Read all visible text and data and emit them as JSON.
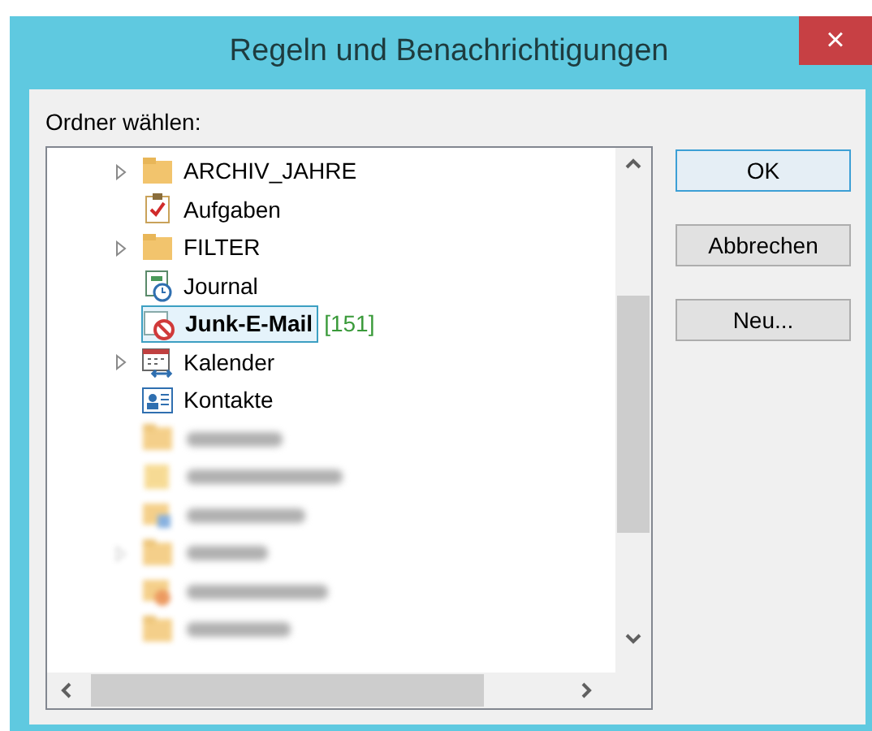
{
  "window": {
    "title": "Regeln und Benachrichtigungen",
    "close": "×"
  },
  "prompt": "Ordner wählen:",
  "folders": [
    {
      "label": "ARCHIV_JAHRE",
      "kind": "folder",
      "expandable": true,
      "selected": false
    },
    {
      "label": "Aufgaben",
      "kind": "tasks",
      "expandable": false,
      "selected": false
    },
    {
      "label": "FILTER",
      "kind": "folder",
      "expandable": true,
      "selected": false
    },
    {
      "label": "Journal",
      "kind": "journal",
      "expandable": false,
      "selected": false
    },
    {
      "label": "Junk-E-Mail",
      "kind": "junk",
      "expandable": false,
      "selected": true,
      "count": "[151]"
    },
    {
      "label": "Kalender",
      "kind": "calendar",
      "expandable": true,
      "selected": false
    },
    {
      "label": "Kontakte",
      "kind": "contacts",
      "expandable": false,
      "selected": false
    },
    {
      "kind": "folder",
      "blurred": true,
      "expandable": false,
      "selected": false
    },
    {
      "kind": "note",
      "blurred": true,
      "expandable": false,
      "selected": false
    },
    {
      "kind": "outbox",
      "blurred": true,
      "expandable": false,
      "selected": false
    },
    {
      "kind": "folder",
      "blurred": true,
      "expandable": true,
      "selected": false
    },
    {
      "kind": "rss",
      "blurred": true,
      "expandable": false,
      "selected": false
    },
    {
      "kind": "folder",
      "blurred": true,
      "expandable": false,
      "selected": false
    }
  ],
  "buttons": [
    {
      "label": "OK",
      "default": true
    },
    {
      "label": "Abbrechen",
      "default": false
    },
    {
      "label": "Neu...",
      "default": false
    }
  ]
}
